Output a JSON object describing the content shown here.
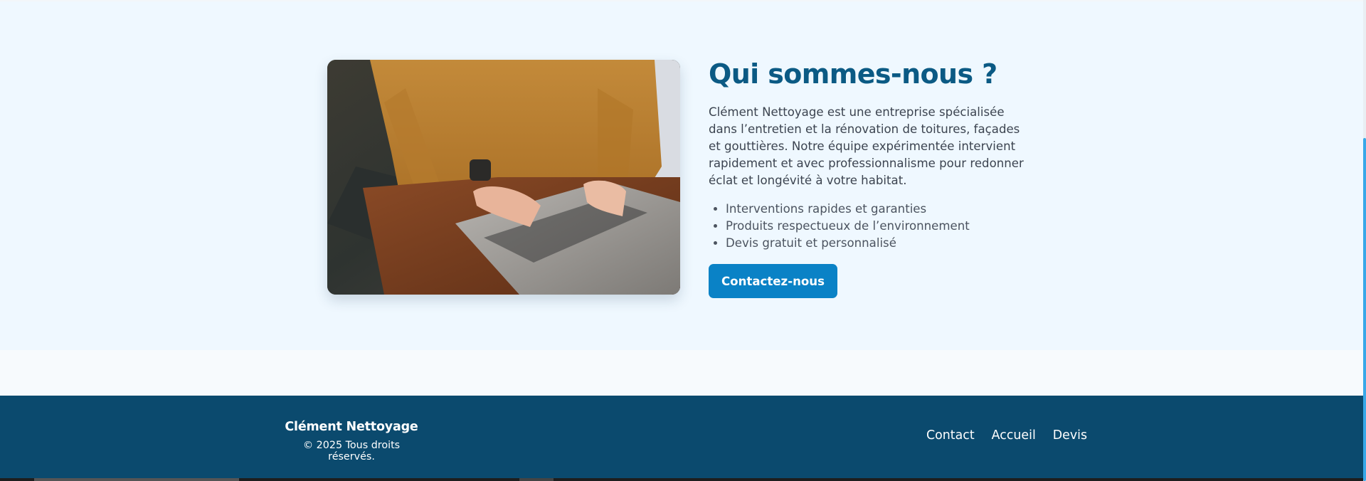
{
  "about": {
    "title": "Qui sommes-nous ?",
    "description": "Clément Nettoyage est une entreprise spécialisée dans l’entretien et la rénovation de toitures, façades et gouttières. Notre équipe expérimentée intervient rapidement et avec professionnalisme pour redonner éclat et longévité à votre habitat.",
    "bullets": [
      "Interventions rapides et garanties",
      "Produits respectueux de l’environnement",
      "Devis gratuit et personnalisé"
    ],
    "cta_label": "Contactez-nous"
  },
  "footer": {
    "brand": "Clément Nettoyage",
    "copyright": "© 2025 Tous droits réservés.",
    "nav": [
      "Contact",
      "Accueil",
      "Devis"
    ]
  },
  "colors": {
    "section_bg": "#eff8ff",
    "title": "#0b5a84",
    "button": "#0a82c6",
    "footer_bg": "#0b4a6e",
    "scroll_thumb": "#39a8e8"
  },
  "icons": {
    "photo": "person-typing-on-laptop-photo"
  }
}
